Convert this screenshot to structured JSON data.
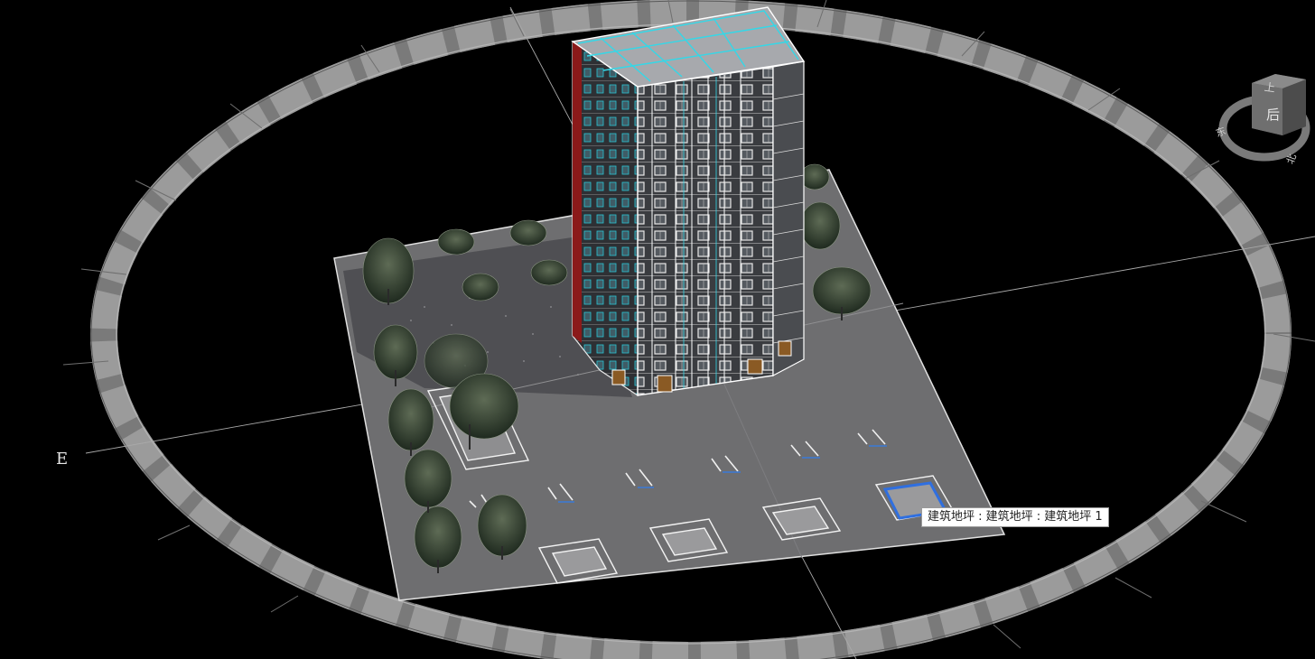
{
  "viewport": {
    "background": "#000000",
    "compass_ring_color": "#8c8c8c",
    "compass_directions": {
      "east": "E"
    },
    "tooltip": {
      "text": "建筑地坪 : 建筑地坪 : 建筑地坪 1"
    },
    "viewcube": {
      "face_top_label": "上",
      "face_front_label": "后",
      "ring_label_left": "东",
      "ring_label_right": "北"
    }
  },
  "scene": {
    "model": "high-rise residential building",
    "site_pad_color": "#6e6e70",
    "curtain_line_color": "#33d8e8",
    "accent_color": "#8b1a1a",
    "selection_color": "#2f6fe0"
  }
}
